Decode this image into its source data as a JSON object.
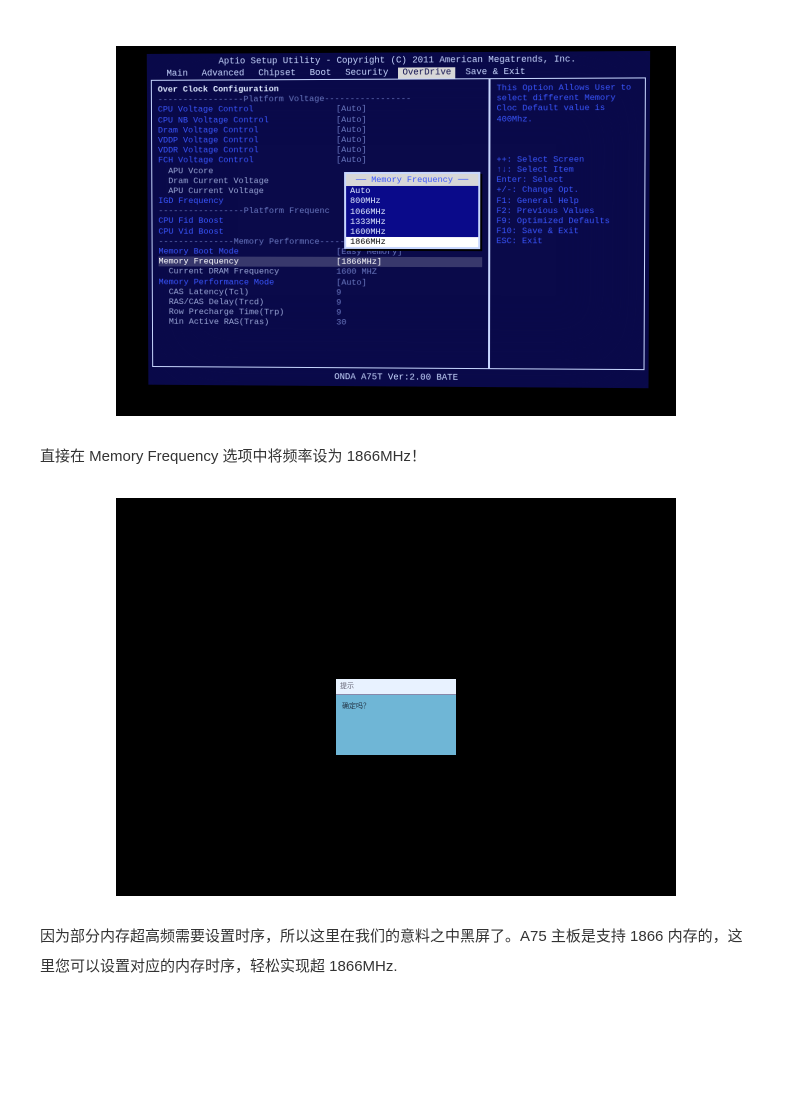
{
  "bios": {
    "title": "Aptio Setup Utility - Copyright (C) 2011 American Megatrends, Inc.",
    "tabs": [
      "Main",
      "Advanced",
      "Chipset",
      "Boot",
      "Security",
      "OverDrive",
      "Save & Exit"
    ],
    "active_tab": "OverDrive",
    "section_title": "Over Clock Configuration",
    "div_platform_voltage": "-----------------Platform Voltage-----------------",
    "rows_voltage": [
      {
        "label": "CPU Voltage Control",
        "value": "[Auto]",
        "blue": true
      },
      {
        "label": "CPU NB Voltage Control",
        "value": "[Auto]",
        "blue": true
      },
      {
        "label": "Dram Voltage Control",
        "value": "[Auto]",
        "blue": true
      },
      {
        "label": "VDDP Voltage Control",
        "value": "[Auto]",
        "blue": true
      },
      {
        "label": "VDDR Voltage Control",
        "value": "[Auto]",
        "blue": true
      },
      {
        "label": "FCH Voltage Control",
        "value": "[Auto]",
        "blue": true
      },
      {
        "label": "  APU Vcore",
        "value": "",
        "blue": false
      },
      {
        "label": "  Dram Current Voltage",
        "value": "",
        "blue": false
      },
      {
        "label": "  APU Current Voltage",
        "value": "",
        "blue": false
      },
      {
        "label": "IGD Frequency",
        "value": "",
        "blue": true
      }
    ],
    "div_platform_freq": "-----------------Platform Frequenc",
    "rows_freq": [
      {
        "label": "CPU Fid Boost",
        "value": "",
        "blue": true
      },
      {
        "label": "CPU Vid Boost",
        "value": "",
        "blue": true
      }
    ],
    "div_memory_perf": "---------------Memory Performnce----------------",
    "rows_mem": [
      {
        "label": "Memory Boot Mode",
        "value": "[Easy Memory]",
        "blue": true,
        "sel": false
      },
      {
        "label": "Memory Frequency",
        "value": "[1866MHz]",
        "blue": true,
        "sel": true
      },
      {
        "label": "  Current DRAM Frequency",
        "value": "1600 MHZ",
        "blue": false
      },
      {
        "label": "Memory Performance Mode",
        "value": "[Auto]",
        "blue": true
      },
      {
        "label": "  CAS Latency(Tcl)",
        "value": "9",
        "blue": false
      },
      {
        "label": "  RAS/CAS Delay(Trcd)",
        "value": "9",
        "blue": false
      },
      {
        "label": "  Row Precharge Time(Trp)",
        "value": "9",
        "blue": false
      },
      {
        "label": "  Min Active RAS(Tras)",
        "value": "30",
        "blue": false
      }
    ],
    "popup": {
      "title": "Memory Frequency",
      "items": [
        "Auto",
        "800MHz",
        "1066MHz",
        "1333MHz",
        "1600MHz",
        "1866MHz"
      ],
      "selected": "1866MHz"
    },
    "help_text": "This Option Allows User to select different Memory Cloc Default value is 400Mhz.",
    "help_keys": [
      "++: Select Screen",
      "↑↓: Select Item",
      "Enter: Select",
      "+/-: Change Opt.",
      "F1: General Help",
      "F2: Previous Values",
      "F9: Optimized Defaults",
      "F10: Save & Exit",
      "ESC: Exit"
    ],
    "footer": "ONDA A75T Ver:2.00 BATE"
  },
  "caption1": "直接在 Memory Frequency 选项中将频率设为 1866MHz！",
  "dialog": {
    "top": "提示",
    "body": "确定吗？"
  },
  "caption2": "因为部分内存超高频需要设置时序，所以这里在我们的意料之中黑屏了。A75 主板是支持 1866 内存的，这里您可以设置对应的内存时序，轻松实现超 1866MHz."
}
